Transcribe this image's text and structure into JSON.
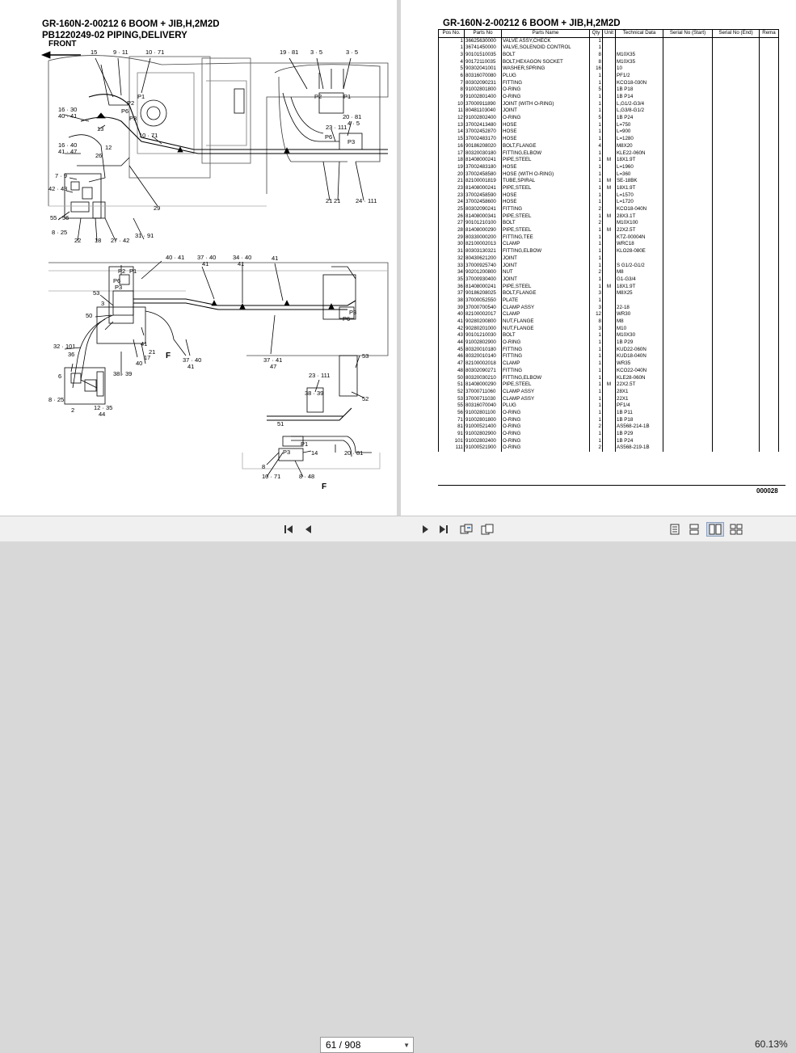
{
  "left_page": {
    "title1": "GR-160N-2-00212 6 BOOM + JIB,H,2M2D",
    "title2": "PB1220249-02 PIPING,DELIVERY",
    "front_label": "FRONT",
    "callouts_top": [
      "15",
      "9 · 11",
      "10 · 71",
      "19 · 81",
      "3 · 5",
      "3 · 5",
      "16 · 30",
      "40 · 41",
      "13",
      "10 · 71",
      "16 · 40",
      "41 · 47",
      "26",
      "7 · 9",
      "42 · 43",
      "55 · 56",
      "8 · 25",
      "22",
      "18",
      "27 · 42",
      "31 · 91",
      "29",
      "23 · 111",
      "20 · 81",
      "4 · 5",
      "21",
      "21",
      "24 · 111",
      "12",
      "P2",
      "P1",
      "P6",
      "P3",
      "P2",
      "P1",
      "P6",
      "P3"
    ],
    "callouts_bottom": [
      "40 · 41",
      "37 · 40",
      "41",
      "34 · 40",
      "41",
      "53",
      "50",
      "3",
      "32 · 101",
      "36",
      "41",
      "17",
      "21",
      "40",
      "38 · 39",
      "37 · 40",
      "41",
      "37 · 40",
      "41",
      "47",
      "6",
      "8 · 25",
      "2",
      "12 · 35",
      "44",
      "F",
      "53",
      "23 · 111",
      "38 · 39",
      "52",
      "51",
      "14",
      "8",
      "10 · 71",
      "8 · 48",
      "20 · 81",
      "F",
      "P2",
      "P1",
      "P6",
      "P3",
      "P6",
      "P3",
      "P3",
      "P1"
    ]
  },
  "right_page": {
    "title": "GR-160N-2-00212 6 BOOM + JIB,H,2M2D",
    "headers": [
      "Pos No.",
      "Parts No",
      "Parts Name",
      "Qty",
      "Unit",
      "Technical Data",
      "Serial No (Start)",
      "Serial No (End)",
      "Rema"
    ],
    "rows": [
      [
        "1",
        "36625630000",
        "VALVE ASSY,CHECK",
        "1",
        "",
        ""
      ],
      [
        "1",
        "36741450000",
        "VALVE,SOLENOID CONTROL",
        "1",
        "",
        ""
      ],
      [
        "3",
        "90101510035",
        "BOLT",
        "8",
        "",
        "M10X35"
      ],
      [
        "4",
        "90172110035",
        "BOLT,HEXAGON SOCKET",
        "8",
        "",
        "M10X35"
      ],
      [
        "5",
        "90302041001",
        "WASHER,SPRING",
        "16",
        "",
        "10"
      ],
      [
        "6",
        "80316070080",
        "PLUG",
        "1",
        "",
        "PF1/2"
      ],
      [
        "7",
        "80302090231",
        "FITTING",
        "1",
        "",
        "KCO18-030N"
      ],
      [
        "8",
        "91002801800",
        "O-RING",
        "5",
        "",
        "1B P18"
      ],
      [
        "9",
        "91002801400",
        "O-RING",
        "1",
        "",
        "1B P14"
      ],
      [
        "10",
        "37000911890",
        "JOINT (WITH O-RING)",
        "1",
        "",
        "L,G1/2-G3/4"
      ],
      [
        "11",
        "80481103040",
        "JOINT",
        "1",
        "",
        "L,G3/8-G1/2"
      ],
      [
        "12",
        "91002802400",
        "O-RING",
        "5",
        "",
        "1B P24"
      ],
      [
        "13",
        "37002413480",
        "HOSE",
        "1",
        "",
        "L=750"
      ],
      [
        "14",
        "37002452870",
        "HOSE",
        "1",
        "",
        "L=900"
      ],
      [
        "15",
        "37002483170",
        "HOSE",
        "1",
        "",
        "L=1280"
      ],
      [
        "16",
        "90186208020",
        "BOLT,FLANGE",
        "4",
        "",
        "M8X20"
      ],
      [
        "17",
        "80320030180",
        "FITTING,ELBOW",
        "1",
        "",
        "KLE22-060N"
      ],
      [
        "18",
        "81408000241",
        "PIPE,STEEL",
        "1",
        "M",
        "18X1.9T"
      ],
      [
        "19",
        "37002483180",
        "HOSE",
        "1",
        "",
        "L=1960"
      ],
      [
        "20",
        "37002458580",
        "HOSE (WITH O-RING)",
        "1",
        "",
        "L=360"
      ],
      [
        "21",
        "82100001819",
        "TUBE,SPIRAL",
        "1",
        "M",
        "SE-18BK"
      ],
      [
        "23",
        "81408000241",
        "PIPE,STEEL",
        "1",
        "M",
        "18X1.9T"
      ],
      [
        "23",
        "37002458590",
        "HOSE",
        "1",
        "",
        "L=1570"
      ],
      [
        "24",
        "37002458600",
        "HOSE",
        "1",
        "",
        "L=1720"
      ],
      [
        "25",
        "80302090241",
        "FITTING",
        "2",
        "",
        "KCO18-040N"
      ],
      [
        "26",
        "81408000341",
        "PIPE,STEEL",
        "1",
        "M",
        "28X3.1T"
      ],
      [
        "27",
        "90101210100",
        "BOLT",
        "2",
        "",
        "M10X100"
      ],
      [
        "28",
        "81408000290",
        "PIPE,STEEL",
        "1",
        "M",
        "22X2.5T"
      ],
      [
        "29",
        "80330000200",
        "FITTING,TEE",
        "1",
        "",
        "KTZ-00004N"
      ],
      [
        "30",
        "82100002013",
        "CLAMP",
        "1",
        "",
        "WRC18"
      ],
      [
        "31",
        "80303130321",
        "FITTING,ELBOW",
        "1",
        "",
        "KLO28-080E"
      ],
      [
        "32",
        "80430621200",
        "JOINT",
        "1",
        "",
        ""
      ],
      [
        "33",
        "37000925740",
        "JOINT",
        "1",
        "",
        "S G1/2-G1/2"
      ],
      [
        "34",
        "90201200800",
        "NUT",
        "2",
        "",
        "M8"
      ],
      [
        "35",
        "37000930400",
        "JOINT",
        "1",
        "",
        "G1-G3/4"
      ],
      [
        "36",
        "81408000241",
        "PIPE,STEEL",
        "1",
        "M",
        "18X1.9T"
      ],
      [
        "37",
        "90186208025",
        "BOLT,FLANGE",
        "3",
        "",
        "M8X25"
      ],
      [
        "38",
        "37000052550",
        "PLATE",
        "1",
        "",
        ""
      ],
      [
        "39",
        "37000700540",
        "CLAMP ASSY",
        "3",
        "",
        "22-18"
      ],
      [
        "40",
        "82100002017",
        "CLAMP",
        "12",
        "",
        "WR30"
      ],
      [
        "41",
        "90280200800",
        "NUT,FLANGE",
        "8",
        "",
        "M8"
      ],
      [
        "42",
        "90280201000",
        "NUT,FLANGE",
        "3",
        "",
        "M10"
      ],
      [
        "43",
        "90101210030",
        "BOLT",
        "1",
        "",
        "M10X30"
      ],
      [
        "44",
        "91002802900",
        "O-RING",
        "1",
        "",
        "1B P29"
      ],
      [
        "45",
        "80320010180",
        "FITTING",
        "1",
        "",
        "KUD22-060N"
      ],
      [
        "46",
        "80320010140",
        "FITTING",
        "1",
        "",
        "KUD18-040N"
      ],
      [
        "47",
        "82100002018",
        "CLAMP",
        "1",
        "",
        "WR35"
      ],
      [
        "48",
        "80302090271",
        "FITTING",
        "1",
        "",
        "KCO22-040N"
      ],
      [
        "50",
        "80320030210",
        "FITTING,ELBOW",
        "1",
        "",
        "KLE28-060N"
      ],
      [
        "51",
        "81408000290",
        "PIPE,STEEL",
        "1",
        "M",
        "22X2.5T"
      ],
      [
        "52",
        "37000711060",
        "CLAMP ASSY",
        "1",
        "",
        "28X1"
      ],
      [
        "53",
        "37000711030",
        "CLAMP ASSY",
        "1",
        "",
        "22X1"
      ],
      [
        "55",
        "80316070040",
        "PLUG",
        "1",
        "",
        "PF1/4"
      ],
      [
        "56",
        "91002801100",
        "O-RING",
        "1",
        "",
        "1B P11"
      ],
      [
        "71",
        "91002801800",
        "O-RING",
        "1",
        "",
        "1B P18"
      ],
      [
        "81",
        "91000521400",
        "O-RING",
        "2",
        "",
        "AS568-214-1B"
      ],
      [
        "91",
        "91002802900",
        "O-RING",
        "1",
        "",
        "1B P29"
      ],
      [
        "101",
        "91002802400",
        "O-RING",
        "1",
        "",
        "1B P24"
      ],
      [
        "111",
        "91000521900",
        "O-RING",
        "2",
        "",
        "AS568-219-1B"
      ]
    ],
    "page_code": "000028"
  },
  "toolbar": {
    "first_icon": "first-page-icon",
    "prev_icon": "prev-page-icon",
    "page_indicator": "61 / 908",
    "next_icon": "next-page-icon",
    "last_icon": "last-page-icon",
    "zoom": "60.13%"
  }
}
